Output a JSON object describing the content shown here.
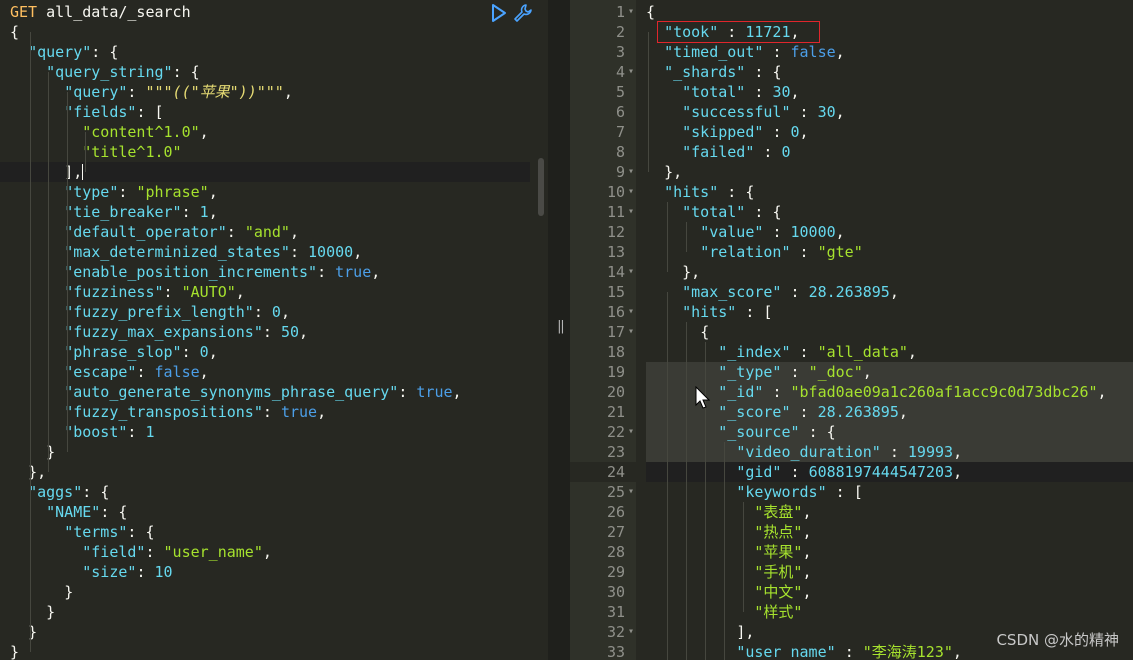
{
  "request": {
    "method": "GET",
    "path": "all_data/_search",
    "run_icon": "play-triangle-icon",
    "settings_icon": "wrench-icon",
    "lines": [
      "{",
      "  \"query\": {",
      "    \"query_string\": {",
      "      \"query\": \"\"\"((\"苹果\"))\"\"\",",
      "      \"fields\": [",
      "        \"content^1.0\",",
      "        \"title^1.0\"",
      "      ],",
      "      \"type\": \"phrase\",",
      "      \"tie_breaker\": 1,",
      "      \"default_operator\": \"and\",",
      "      \"max_determinized_states\": 10000,",
      "      \"enable_position_increments\": true,",
      "      \"fuzziness\": \"AUTO\",",
      "      \"fuzzy_prefix_length\": 0,",
      "      \"fuzzy_max_expansions\": 50,",
      "      \"phrase_slop\": 0,",
      "      \"escape\": false,",
      "      \"auto_generate_synonyms_phrase_query\": true,",
      "      \"fuzzy_transpositions\": true,",
      "      \"boost\": 1",
      "    }",
      "  },",
      "  \"aggs\": {",
      "    \"NAME\": {",
      "      \"terms\": {",
      "        \"field\": \"user_name\",",
      "        \"size\": 10",
      "      }",
      "    }",
      "  }",
      "}"
    ]
  },
  "response": {
    "line_numbers": [
      1,
      2,
      3,
      4,
      5,
      6,
      7,
      8,
      9,
      10,
      11,
      12,
      13,
      14,
      15,
      16,
      17,
      18,
      19,
      20,
      21,
      22,
      23,
      24,
      25,
      26,
      27,
      28,
      29,
      30,
      31,
      32,
      33
    ],
    "fold_markers": [
      1,
      4,
      9,
      10,
      11,
      14,
      16,
      17,
      22,
      25,
      32
    ],
    "lines": [
      "{",
      "  \"took\" : 11721,",
      "  \"timed_out\" : false,",
      "  \"_shards\" : {",
      "    \"total\" : 30,",
      "    \"successful\" : 30,",
      "    \"skipped\" : 0,",
      "    \"failed\" : 0",
      "  },",
      "  \"hits\" : {",
      "    \"total\" : {",
      "      \"value\" : 10000,",
      "      \"relation\" : \"gte\"",
      "    },",
      "    \"max_score\" : 28.263895,",
      "    \"hits\" : [",
      "      {",
      "        \"_index\" : \"all_data\",",
      "        \"_type\" : \"_doc\",",
      "        \"_id\" : \"bfad0ae09a1c260af1acc9c0d73dbc26\",",
      "        \"_score\" : 28.263895,",
      "        \"_source\" : {",
      "          \"video_duration\" : 19993,",
      "          \"gid\" : 6088197444547203,",
      "          \"keywords\" : [",
      "            \"表盘\",",
      "            \"热点\",",
      "            \"苹果\",",
      "            \"手机\",",
      "            \"中文\",",
      "            \"样式\"",
      "          ],",
      "          \"user_name\" : \"李海涛123\","
    ]
  },
  "divider_grip": "‖",
  "watermark": "CSDN @水的精神",
  "colors": {
    "background": "#272822",
    "key": "#66d9ef",
    "string": "#a6e22e",
    "boolean": "#4c9fe8",
    "highlight_box": "#e0262c"
  }
}
